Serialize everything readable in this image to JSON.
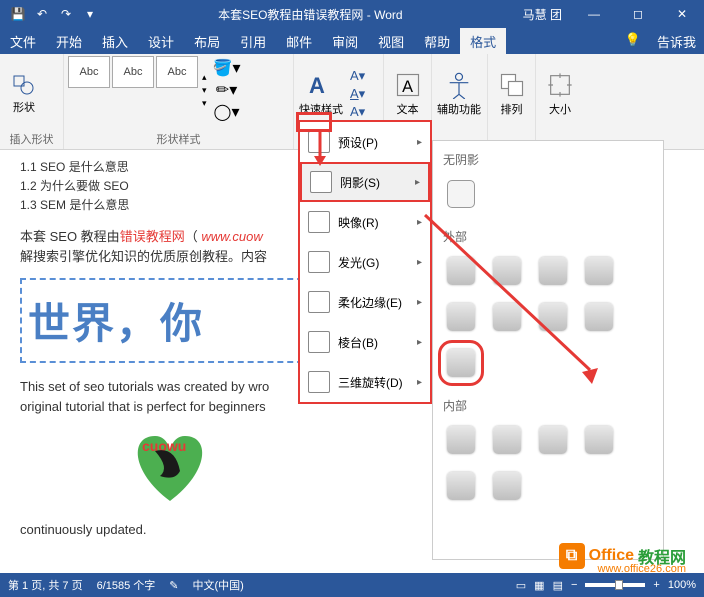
{
  "titlebar": {
    "title": "本套SEO教程由错误教程网 - Word",
    "user": "马慧  团"
  },
  "menubar": {
    "tabs": [
      "文件",
      "开始",
      "插入",
      "设计",
      "布局",
      "引用",
      "邮件",
      "审阅",
      "视图",
      "帮助",
      "格式"
    ],
    "active_index": 10,
    "tell_me": "告诉我"
  },
  "ribbon": {
    "insert_shape": "形状",
    "insert_shape_group": "插入形状",
    "shape_preset_label": "Abc",
    "shape_style_group": "形状样式",
    "quick_style": "快速样式",
    "text": "文本",
    "accessibility": "辅助功能",
    "arrange": "排列",
    "size": "大小"
  },
  "effects_menu": {
    "items": [
      {
        "label": "预设(P)"
      },
      {
        "label": "阴影(S)",
        "highlight": true
      },
      {
        "label": "映像(R)"
      },
      {
        "label": "发光(G)"
      },
      {
        "label": "柔化边缘(E)"
      },
      {
        "label": "棱台(B)"
      },
      {
        "label": "三维旋转(D)"
      }
    ]
  },
  "shadow_panel": {
    "no_shadow": "无阴影",
    "outer": "外部",
    "inner": "内部"
  },
  "document": {
    "toc1": "1.1 SEO 是什么意思",
    "toc2": "1.2 为什么要做 SEO",
    "toc3": "1.3 SEM 是什么意思",
    "para1_a": "本套 SEO 教程由",
    "para1_b": "错误教程网",
    "para1_c": "（",
    "para1_url": "www.cuow",
    "para2": "解搜索引擎优化知识的优质原创教程。内容",
    "wordart": "世界，你",
    "para3": "This set of seo tutorials was created by wro",
    "para4": "original tutorial that is perfect for beginners",
    "heart_text": "cuowu",
    "para5": "continuously updated."
  },
  "statusbar": {
    "page": "第 1 页, 共 7 页",
    "words": "6/1585 个字",
    "lang": "中文(中国)",
    "zoom": "100%"
  },
  "watermark": {
    "brand1": "Office",
    "brand2": "教程网",
    "url": "www.office26.com"
  }
}
